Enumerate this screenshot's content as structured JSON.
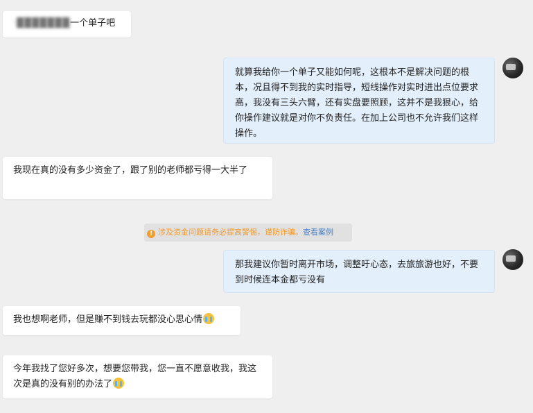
{
  "messages": [
    {
      "side": "left",
      "blurred": "·███████",
      "text": "一个单子吧"
    },
    {
      "side": "right",
      "text": "就算我给你一个单子又能如何呢，这根本不是解决问题的根本，况且得不到我的实时指导，短线操作对实时进出点位要求高，我没有三头六臂，还有实盘要照顾，这并不是我狠心，给你操作建议就是对你不负责任。在加上公司也不允许我们这样操作。"
    },
    {
      "side": "left",
      "text": "我现在真的没有多少资金了，跟了别的老师都亏得一大半了"
    },
    {
      "side": "right",
      "text": "那我建议你暂时离开市场，调整吁心态，去旅旅游也好，不要到时候连本金都亏没有"
    },
    {
      "side": "left",
      "text": "我也想啊老师，但是赚不到钱去玩都没心思心情"
    },
    {
      "side": "left",
      "text": "今年我找了您好多次，想要您带我，您一直不愿意收我，我这次是真的没有别的办法了"
    }
  ],
  "notice": {
    "icon": "warning-icon",
    "text": "涉及资金问题请务必提高警惕，谨防诈骗。",
    "link": "查看案例"
  },
  "emoji": "crying-face-emoji",
  "colors": {
    "background": "#efefef",
    "left_bubble": "#ffffff",
    "right_bubble": "#e3effb",
    "notice_warn": "#f09a2d",
    "notice_link": "#4a7fc0"
  }
}
